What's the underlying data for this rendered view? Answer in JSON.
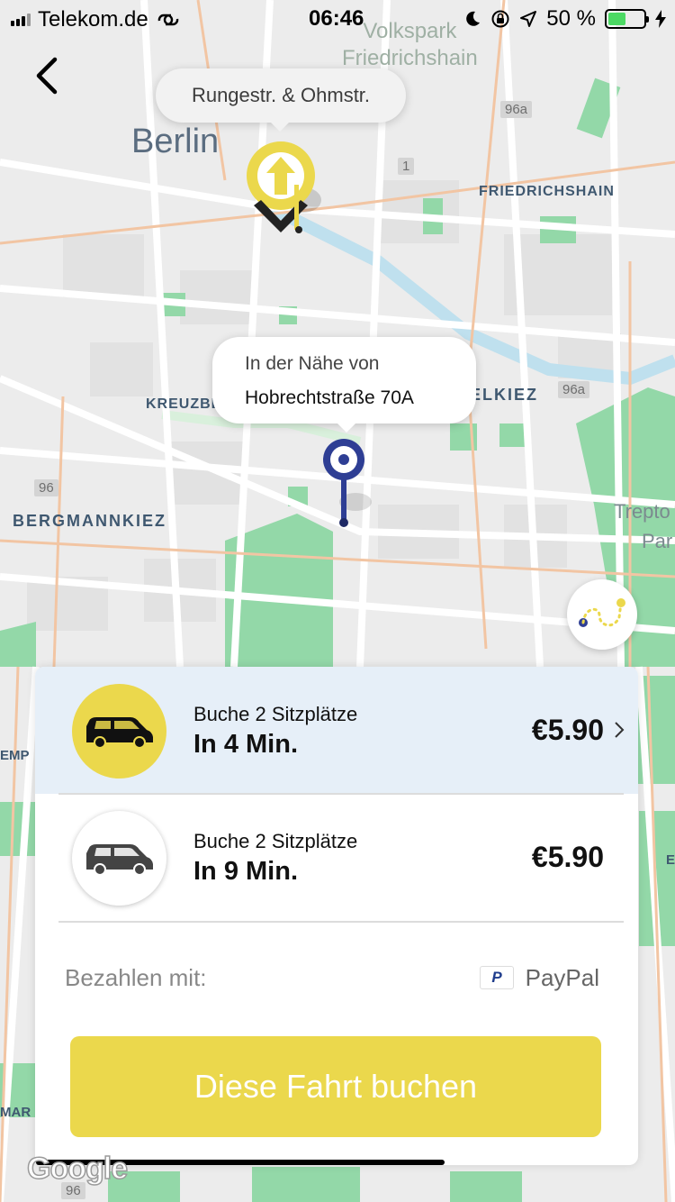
{
  "status_bar": {
    "carrier": "Telekom.de",
    "time": "06:46",
    "battery_percent": "50 %",
    "battery_level": 0.5
  },
  "map": {
    "labels": {
      "city": "Berlin",
      "park": "Volkspark\nFriedrichshain",
      "friedrichshain": "FRIEDRICHSHAIN",
      "kreuzberg": "KREUZBE",
      "reuterkiez": "ELKIEZ",
      "bergmannkiez": "BERGMANNKIEZ",
      "treptow_1": "Trepto",
      "treptow_2": "Par",
      "tempelhof": "EMP",
      "mar": "MAR",
      "east_e": "E"
    },
    "route_badges": [
      "96a",
      "1",
      "96a",
      "96",
      "96"
    ],
    "attribution": "Google"
  },
  "pickup": {
    "label": "Rungestr. & Ohmstr."
  },
  "dropoff": {
    "label_line1": "In der Nähe von",
    "label_line2": "Hobrechtstraße 70A"
  },
  "ride_options": [
    {
      "seats": "Buche 2 Sitzplätze",
      "eta": "In 4 Min.",
      "price": "€5.90",
      "icon": "van-icon",
      "selected": true
    },
    {
      "seats": "Buche 2 Sitzplätze",
      "eta": "In 9 Min.",
      "price": "€5.90",
      "icon": "van-icon",
      "selected": false
    }
  ],
  "payment": {
    "label": "Bezahlen mit:",
    "method": "PayPal",
    "icon": "paypal-icon"
  },
  "book_button": {
    "label": "Diese Fahrt buchen"
  },
  "colors": {
    "accent_yellow": "#ebd84c",
    "selected_row": "#e6eff8",
    "pin_blue": "#2e3e94",
    "park_green": "#93d8a8",
    "road_orange": "#f2c5a3"
  }
}
